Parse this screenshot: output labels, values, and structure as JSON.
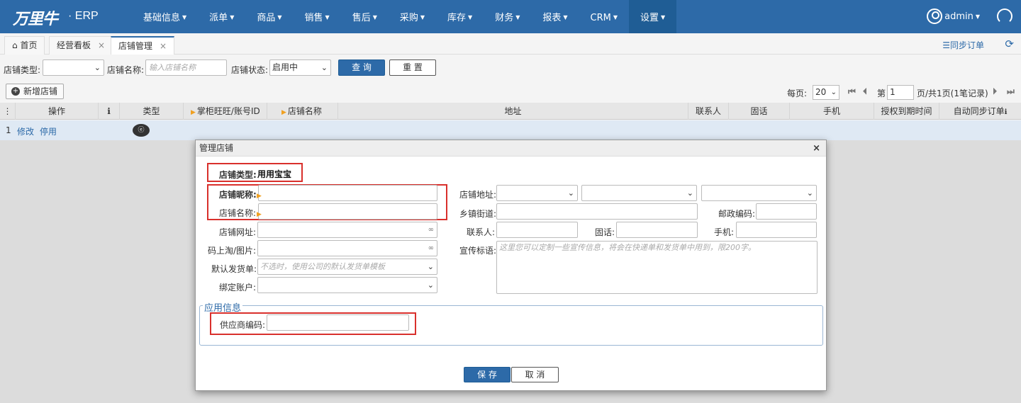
{
  "app": {
    "logo": "万里牛",
    "logo_suffix": "· ERP"
  },
  "nav": {
    "items": [
      {
        "label": "基础信息"
      },
      {
        "label": "派单"
      },
      {
        "label": "商品"
      },
      {
        "label": "销售"
      },
      {
        "label": "售后"
      },
      {
        "label": "采购"
      },
      {
        "label": "库存"
      },
      {
        "label": "财务"
      },
      {
        "label": "报表"
      },
      {
        "label": "CRM"
      },
      {
        "label": "设置"
      }
    ],
    "active": "设置",
    "user": "admin"
  },
  "tabs": {
    "home": "首页",
    "t1": "经营看板",
    "t2": "店铺管理",
    "close": "×",
    "sync_orders": "同步订单"
  },
  "filters": {
    "shop_type_label": "店铺类型:",
    "shop_name_label": "店铺名称:",
    "shop_name_placeholder": "输入店铺名称",
    "shop_status_label": "店铺状态:",
    "shop_status_value": "启用中",
    "query": "查 询",
    "reset": "重 置"
  },
  "toolbar": {
    "add_shop": "新增店铺",
    "per_page_label": "每页:",
    "per_page_value": "20",
    "page_label": "第",
    "page_value": "1",
    "page_total": "页/共1页(1笔记录)"
  },
  "grid": {
    "headers": {
      "menu": "⋮",
      "ops": "操作",
      "info": "ℹ",
      "type": "类型",
      "account": "掌柜旺旺/账号ID",
      "shop_name": "店铺名称",
      "address": "地址",
      "contact": "联系人",
      "phone": "固话",
      "mobile": "手机",
      "auth_expire": "授权到期时间",
      "auto_sync": "自动同步订单"
    },
    "rows": [
      {
        "index": "1",
        "edit": "修改",
        "disable": "停用",
        "type_icon": "ⓔ"
      }
    ]
  },
  "modal": {
    "title": "管理店铺",
    "close": "×",
    "shop_type_label": "店铺类型:",
    "shop_type_value": "用用宝宝",
    "nickname_label": "店铺昵称:",
    "shop_name_label": "店铺名称:",
    "shop_url_label": "店铺网址:",
    "code_image_label": "码上淘/图片:",
    "default_invoice_label": "默认发货单:",
    "default_invoice_placeholder": "不选时，使用公司的默认发货单模板",
    "bind_account_label": "绑定账户:",
    "address_label": "店铺地址:",
    "street_label": "乡镇街道:",
    "postcode_label": "邮政编码:",
    "contact_label": "联系人:",
    "phone_label": "固话:",
    "mobile_label": "手机:",
    "slogan_label": "宣传标语:",
    "slogan_placeholder": "这里您可以定制一些宣传信息，将会在快递单和发货单中用到，限200字。",
    "app_info_legend": "应用信息",
    "supplier_code_label": "供应商编码:",
    "save": "保 存",
    "cancel": "取 消"
  },
  "colors": {
    "brand": "#2d6aa8",
    "highlight_box": "#d9302c",
    "row_selected": "#dfe9f4"
  }
}
